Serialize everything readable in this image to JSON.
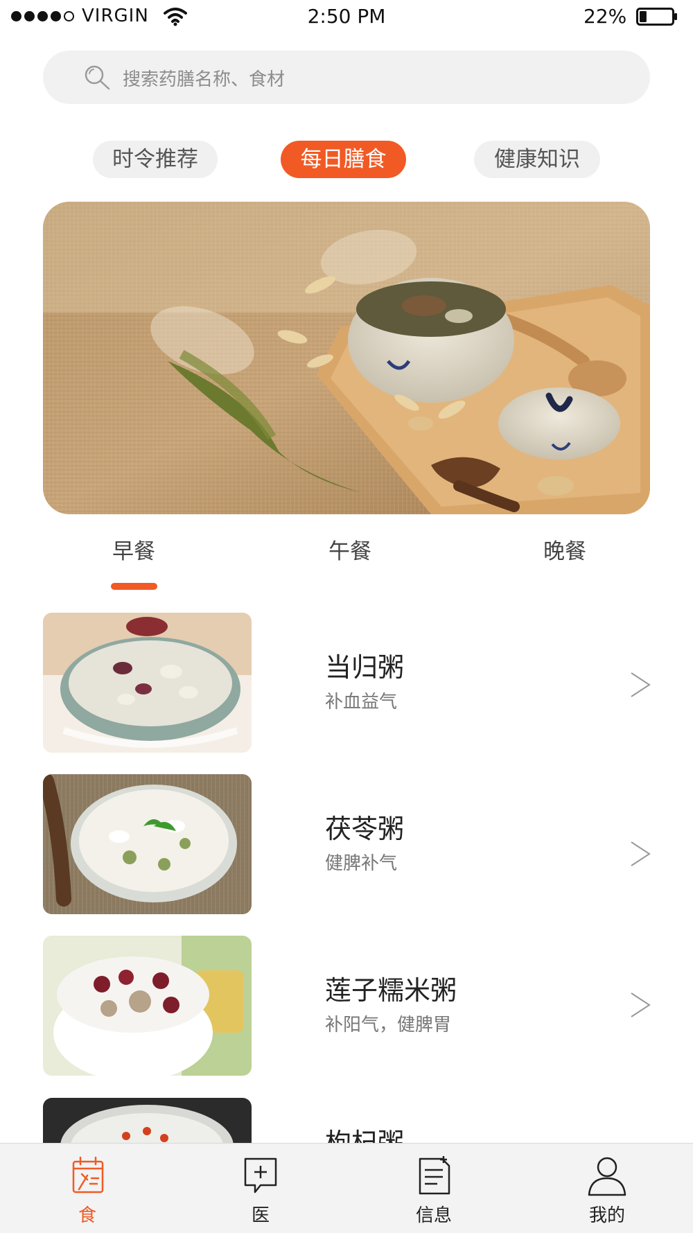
{
  "status_bar": {
    "carrier": "VIRGIN",
    "time": "2:50 PM",
    "battery_percent": "22%",
    "battery_level": 0.22,
    "signal_bars_filled": 4,
    "signal_bars_total": 5
  },
  "search": {
    "placeholder": "搜索药膳名称、食材",
    "icon": "search-icon"
  },
  "category_tabs": [
    {
      "label": "时令推荐",
      "active": false
    },
    {
      "label": "每日膳食",
      "active": true
    },
    {
      "label": "健康知识",
      "active": false
    }
  ],
  "meal_tabs": [
    {
      "label": "早餐",
      "active": true
    },
    {
      "label": "午餐",
      "active": false
    },
    {
      "label": "晚餐",
      "active": false
    }
  ],
  "recipes": [
    {
      "title": "当归粥",
      "subtitle": "补血益气"
    },
    {
      "title": "茯苓粥",
      "subtitle": "健脾补气"
    },
    {
      "title": "莲子糯米粥",
      "subtitle": "补阳气，健脾胃"
    },
    {
      "title": "枸杞粥",
      "subtitle": ""
    }
  ],
  "bottom_nav": [
    {
      "label": "食",
      "icon": "food-calendar-icon",
      "active": true
    },
    {
      "label": "医",
      "icon": "medical-chat-icon",
      "active": false
    },
    {
      "label": "信息",
      "icon": "document-icon",
      "active": false
    },
    {
      "label": "我的",
      "icon": "user-icon",
      "active": false
    }
  ],
  "colors": {
    "accent": "#f15a24",
    "tab_bg": "#f0f0f0",
    "nav_bg": "#f3f3f3"
  }
}
